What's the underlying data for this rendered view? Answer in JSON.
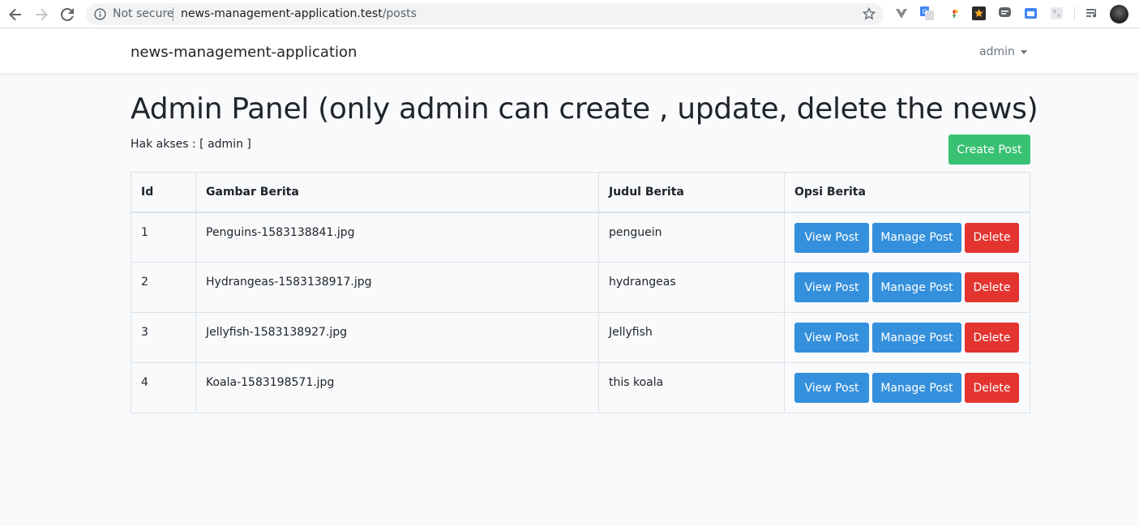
{
  "browser": {
    "security_label": "Not secure",
    "url_host": "news-management-application.test",
    "url_path": "/posts"
  },
  "navbar": {
    "brand": "news-management-application",
    "user": "admin"
  },
  "page": {
    "title": "Admin Panel (only admin can create , update, delete the news)",
    "access_label": "Hak akses : [ admin ]",
    "create_button": "Create Post"
  },
  "table": {
    "headers": [
      "Id",
      "Gambar Berita",
      "Judul Berita",
      "Opsi Berita"
    ],
    "rows": [
      {
        "id": "1",
        "image": "Penguins-1583138841.jpg",
        "title": "penguein"
      },
      {
        "id": "2",
        "image": "Hydrangeas-1583138917.jpg",
        "title": "hydrangeas"
      },
      {
        "id": "3",
        "image": "Jellyfish-1583138927.jpg",
        "title": "Jellyfish"
      },
      {
        "id": "4",
        "image": "Koala-1583198571.jpg",
        "title": "this koala"
      }
    ],
    "actions": {
      "view": "View Post",
      "manage": "Manage Post",
      "delete": "Delete"
    }
  },
  "colors": {
    "success": "#38c172",
    "primary": "#3490dc",
    "danger": "#e3342f",
    "background": "#f8fafc"
  }
}
